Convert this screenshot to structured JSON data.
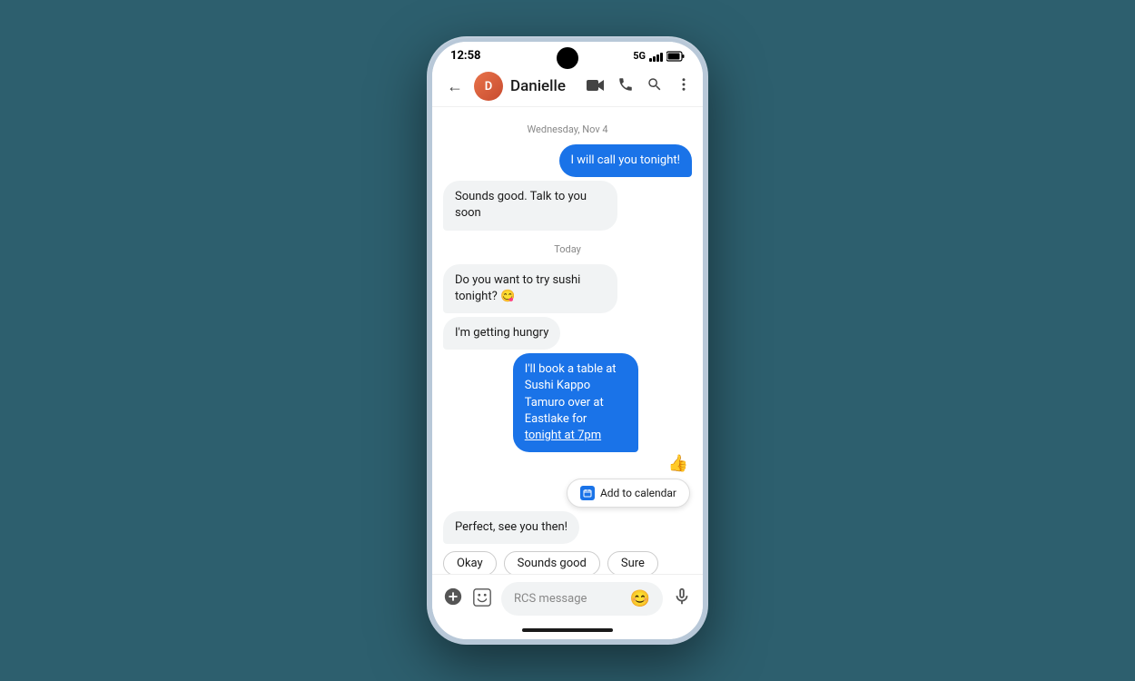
{
  "status": {
    "time": "12:58",
    "network": "5G",
    "camera_label": "camera-notch"
  },
  "header": {
    "back_label": "←",
    "contact_name": "Danielle",
    "contact_initials": "D",
    "video_icon": "video-call-icon",
    "phone_icon": "phone-icon",
    "search_icon": "search-icon",
    "more_icon": "more-options-icon"
  },
  "chat": {
    "date_divider_1": "Wednesday, Nov 4",
    "date_divider_2": "Today",
    "messages": [
      {
        "id": "msg1",
        "type": "sent",
        "text": "I will call you tonight!"
      },
      {
        "id": "msg2",
        "type": "received",
        "text": "Sounds good. Talk to you soon"
      },
      {
        "id": "msg3",
        "type": "received",
        "text": "Do you want to try sushi tonight? 😋"
      },
      {
        "id": "msg4",
        "type": "received",
        "text": "I'm getting hungry"
      },
      {
        "id": "msg5",
        "type": "sent",
        "text": "I'll book a table at Sushi Kappo Tamuro over at Eastlake for tonight at 7pm"
      },
      {
        "id": "msg6",
        "type": "received",
        "text": "Perfect, see you then!"
      }
    ],
    "emoji_reaction": "👍",
    "add_to_calendar_label": "Add to calendar",
    "quick_replies": [
      "Okay",
      "Sounds good",
      "Sure"
    ]
  },
  "input_bar": {
    "placeholder": "RCS message",
    "add_icon": "+",
    "sticker_icon": "sticker-icon",
    "emoji_icon": "😊",
    "mic_icon": "🎤"
  }
}
